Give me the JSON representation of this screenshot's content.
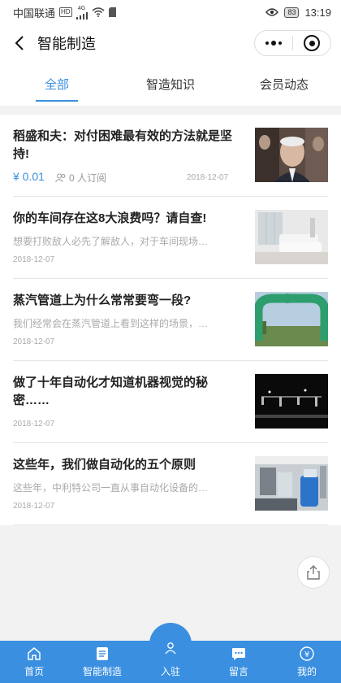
{
  "status_bar": {
    "carrier": "中国联通",
    "hd": "HD",
    "network": "4G",
    "battery": "83",
    "time": "13:19"
  },
  "navbar": {
    "title": "智能制造"
  },
  "tabs": [
    {
      "label": "全部",
      "active": true
    },
    {
      "label": "智造知识",
      "active": false
    },
    {
      "label": "会员动态",
      "active": false
    }
  ],
  "articles": [
    {
      "title": "稻盛和夫：对付困难最有效的方法就是坚持!",
      "price": "¥ 0.01",
      "subscribers": "0 人订阅",
      "date": "2018-12-07",
      "thumb": "portrait"
    },
    {
      "title": "你的车间存在这8大浪费吗？请自查!",
      "desc": "想要打败敌人必先了解敌人，对于车间现场…",
      "date": "2018-12-07",
      "thumb": "sofa"
    },
    {
      "title": "蒸汽管道上为什么常常要弯一段?",
      "desc": "我们经常会在蒸汽管道上看到这样的场景，…",
      "date": "2018-12-07",
      "thumb": "pipe"
    },
    {
      "title": "做了十年自动化才知道机器视觉的秘密……",
      "desc": "",
      "date": "2018-12-07",
      "thumb": "machine-vision"
    },
    {
      "title": "这些年，我们做自动化的五个原则",
      "desc": "这些年，中利特公司一直从事自动化设备的…",
      "date": "2018-12-07",
      "thumb": "factory"
    }
  ],
  "tabbar": [
    {
      "label": "首页",
      "icon": "home-icon"
    },
    {
      "label": "智能制造",
      "icon": "document-icon"
    },
    {
      "label": "入驻",
      "icon": "user-icon"
    },
    {
      "label": "留言",
      "icon": "message-icon"
    },
    {
      "label": "我的",
      "icon": "yen-icon"
    }
  ],
  "colors": {
    "accent": "#3a8fe0",
    "muted": "#aaaaaa"
  }
}
